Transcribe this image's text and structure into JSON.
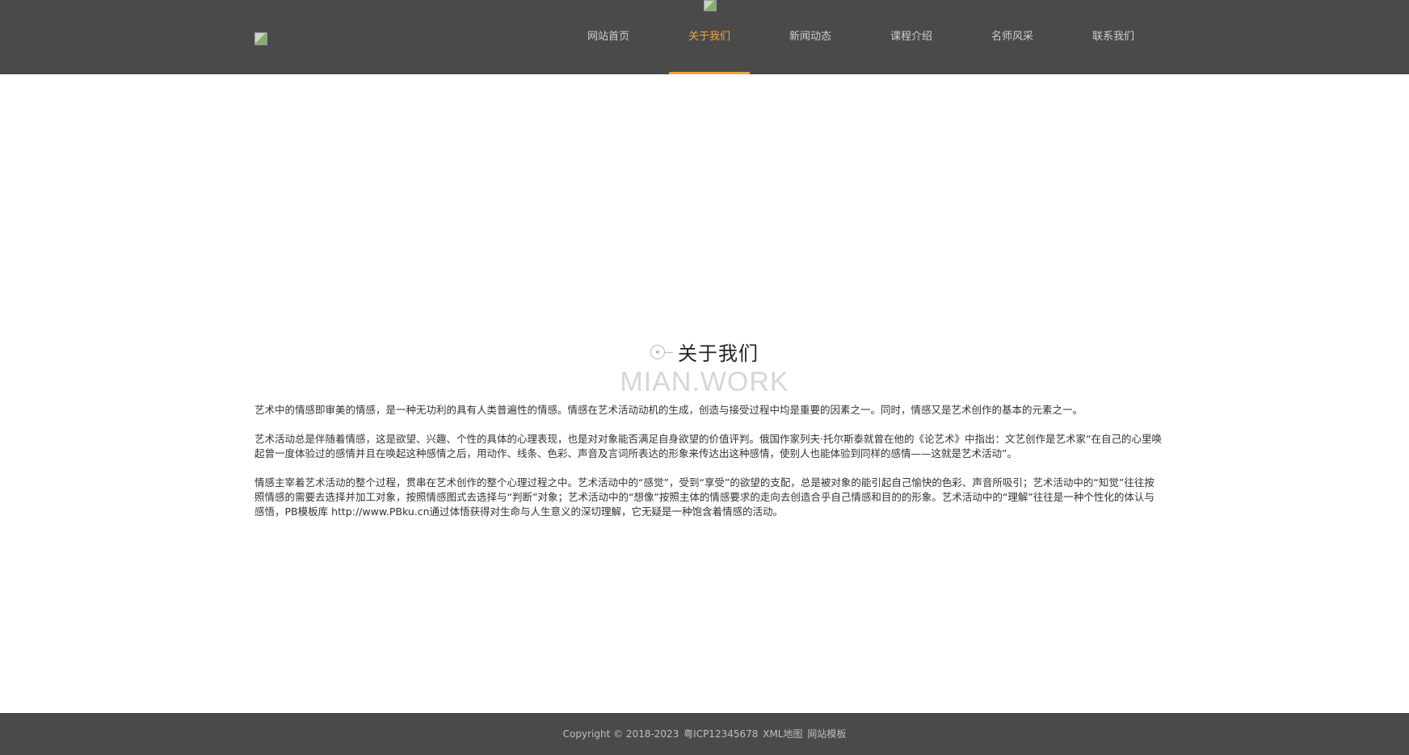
{
  "header": {
    "logo_icon": "broken-image-icon",
    "top_image_icon": "broken-image-icon",
    "nav": [
      {
        "label": "网站首页",
        "active": false
      },
      {
        "label": "关于我们",
        "active": true
      },
      {
        "label": "新闻动态",
        "active": false
      },
      {
        "label": "课程介绍",
        "active": false
      },
      {
        "label": "名师风采",
        "active": false
      },
      {
        "label": "联系我们",
        "active": false
      }
    ],
    "colors": {
      "background": "#4a4a4a",
      "nav_text": "#cfcfcf",
      "accent": "#f0a43a"
    }
  },
  "section": {
    "icon": "target-line-icon",
    "title": "关于我们",
    "subtitle": "MIAN.WORK"
  },
  "content": {
    "paragraphs": [
      "艺术中的情感即审美的情感，是一种无功利的具有人类普遍性的情感。情感在艺术活动动机的生成，创造与接受过程中均是重要的因素之一。同时，情感又是艺术创作的基本的元素之一。",
      "艺术活动总是伴随着情感，这是欲望、兴趣、个性的具体的心理表现，也是对对象能否满足自身欲望的价值评判。俄国作家列夫·托尔斯泰就曾在他的《论艺术》中指出：文艺创作是艺术家“在自己的心里唤起曾一度体验过的感情并且在唤起这种感情之后，用动作、线条、色彩、声音及言词所表达的形象来传达出这种感情，使别人也能体验到同样的感情——这就是艺术活动”。",
      "情感主宰着艺术活动的整个过程，贯串在艺术创作的整个心理过程之中。艺术活动中的“感觉”，受到“享受”的欲望的支配，总是被对象的能引起自己愉快的色彩、声音所吸引；艺术活动中的“知觉”往往按照情感的需要去选择并加工对象，按照情感图式去选择与“判断”对象；艺术活动中的“想像”按照主体的情感要求的走向去创造合乎自己情感和目的的形象。艺术活动中的“理解”往往是一种个性化的体认与感悟，PB模板库 http://www.PBku.cn通过体悟获得对生命与人生意义的深切理解，它无疑是一种饱含着情感的活动。"
    ]
  },
  "footer": {
    "copyright": "Copyright © 2018-2023",
    "icp": "粤ICP12345678",
    "xml_map": "XML地图",
    "template": "网站模板",
    "colors": {
      "background": "#4a4a4a",
      "text": "#bfbfbf"
    }
  }
}
